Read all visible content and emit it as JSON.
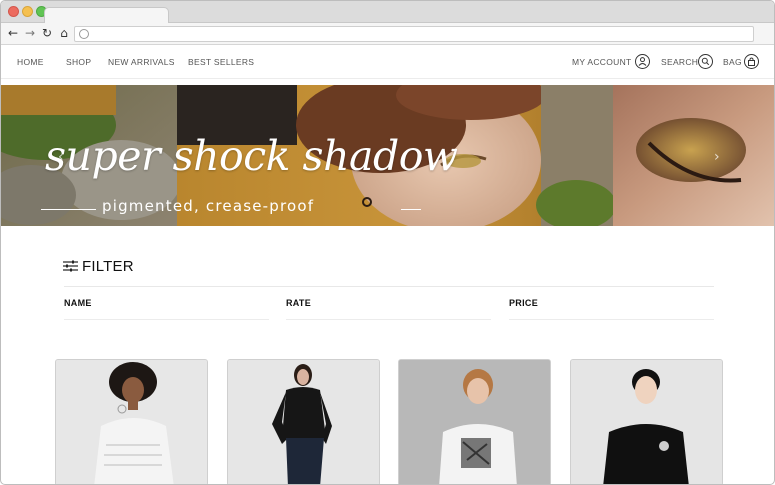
{
  "nav": {
    "left": [
      "HOME",
      "SHOP",
      "NEW ARRIVALS",
      "BEST SELLERS"
    ],
    "account": "MY ACCOUNT",
    "search": "SEARCH",
    "bag": "BAG"
  },
  "hero": {
    "title": "super shock shadow",
    "subtitle": "pigmented, crease-proof"
  },
  "filter": {
    "title": "FILTER",
    "columns": [
      "NAME",
      "RATE",
      "PRICE"
    ]
  },
  "icons": {
    "back": "back-arrow-icon",
    "forward": "forward-arrow-icon",
    "reload": "reload-icon",
    "home": "home-icon",
    "account": "user-icon",
    "search": "search-icon",
    "bag": "bag-icon",
    "filter": "sliders-icon"
  },
  "colors": {
    "hero_gold": "#b9862e",
    "card_bg": "#e4e4e4"
  }
}
